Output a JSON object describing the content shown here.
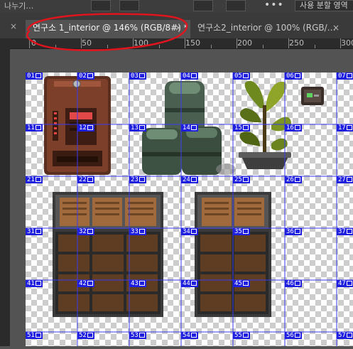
{
  "topbar": {
    "menu_text": "나누기…",
    "more": "•••",
    "workspace": "사용 분할 영역"
  },
  "tabs": [
    {
      "label": "연구소 1_interior @ 146% (RGB/8#) *",
      "close": "×",
      "active": true
    },
    {
      "label": "연구소2_interior @ 100% (RGB/…",
      "close": "×",
      "active": false
    }
  ],
  "tab_overflow_close": "×",
  "ruler": {
    "labels": [
      "0",
      "50",
      "100",
      "150",
      "200",
      "250",
      "300"
    ]
  },
  "slices": {
    "rows": [
      [
        "01",
        "02",
        "03",
        "04",
        "05",
        "06",
        "07"
      ],
      [
        "11",
        "12",
        "13",
        "14",
        "15",
        "16",
        "17"
      ],
      [
        "21",
        "22",
        "23",
        "24",
        "25",
        "26",
        "27"
      ],
      [
        "31",
        "32",
        "33",
        "34",
        "35",
        "36",
        "37"
      ],
      [
        "41",
        "42",
        "43",
        "44",
        "45",
        "46",
        "47"
      ],
      [
        "51",
        "52",
        "53",
        "54",
        "55",
        "56",
        "57"
      ]
    ]
  },
  "sprites": [
    "vending-machine",
    "barrels",
    "potted-plant",
    "wall-switch",
    "crate-shelf-large",
    "crate-shelf-small"
  ],
  "colors": {
    "slice_blue": "#1f1fe0",
    "annotation_red": "#e0141c",
    "tab_active": "#535353"
  }
}
